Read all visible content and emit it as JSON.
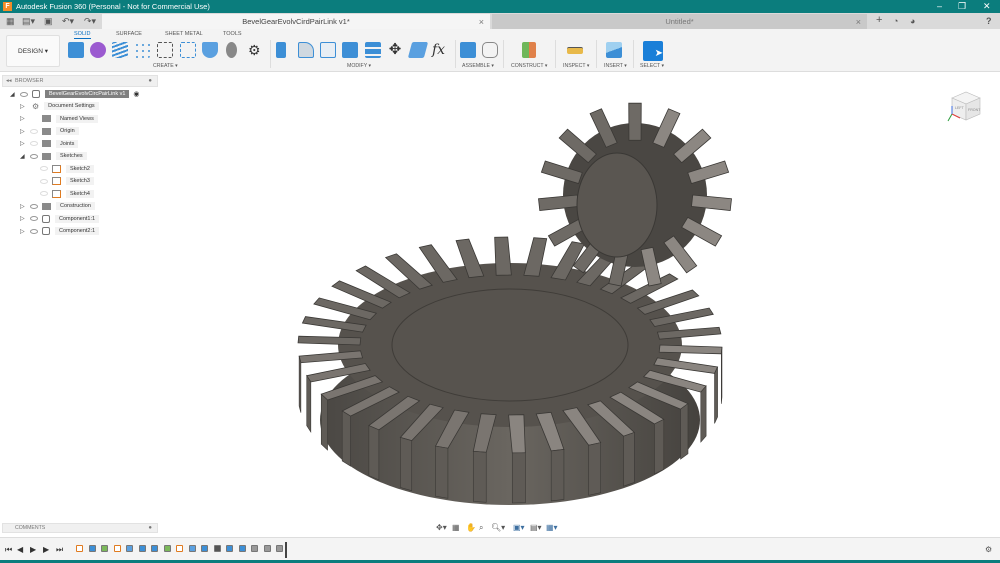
{
  "app": {
    "title": "Autodesk Fusion 360 (Personal - Not for Commercial Use)",
    "logo": "F"
  },
  "window_controls": {
    "minimize": "–",
    "restore": "❐",
    "close": "✕"
  },
  "tabs": [
    {
      "label": "BevelGearEvolvCirdPairLink v1*",
      "active": true
    },
    {
      "label": "Untitled*",
      "active": false
    }
  ],
  "tab_actions": {
    "new_tab": "+",
    "help": "?"
  },
  "toolbar": {
    "workspace": "DESIGN ▾",
    "tabs": [
      "SOLID",
      "SURFACE",
      "SHEET METAL",
      "TOOLS"
    ],
    "groups": [
      "CREATE ▾",
      "MODIFY ▾",
      "ASSEMBLE ▾",
      "CONSTRUCT ▾",
      "INSPECT ▾",
      "INSERT ▾",
      "SELECT ▾"
    ],
    "fx": "fx"
  },
  "browser": {
    "title": "BROWSER",
    "root": "BevelGearEvolvCircPairLink v1",
    "items": [
      {
        "label": "Document Settings",
        "type": "gear"
      },
      {
        "label": "Named Views",
        "type": "folder"
      },
      {
        "label": "Origin",
        "type": "folder"
      },
      {
        "label": "Joints",
        "type": "folder"
      },
      {
        "label": "Sketches",
        "type": "folder"
      },
      {
        "label": "Sketch2",
        "type": "sketch"
      },
      {
        "label": "Sketch3",
        "type": "sketch"
      },
      {
        "label": "Sketch4",
        "type": "sketch"
      },
      {
        "label": "Construction",
        "type": "folder"
      },
      {
        "label": "Component1:1",
        "type": "component"
      },
      {
        "label": "Component2:1",
        "type": "component"
      }
    ]
  },
  "comments": {
    "title": "COMMENTS"
  },
  "viewcube": {
    "left": "LEFT",
    "front": "FRONT"
  },
  "colors": {
    "titlebar": "#0b7d7d",
    "accent": "#0a6fc2",
    "gear": "#5e5a55"
  }
}
